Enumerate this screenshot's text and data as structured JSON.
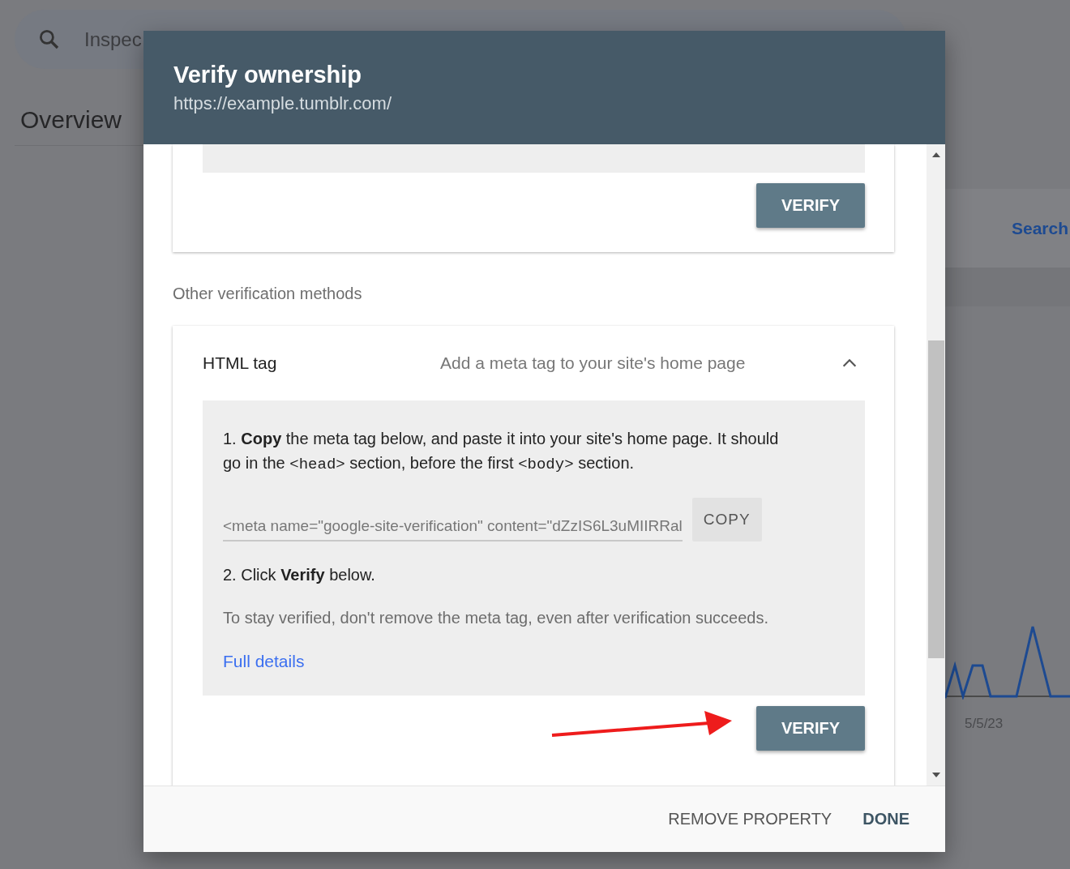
{
  "background": {
    "search": {
      "value": "Inspec"
    },
    "heading": "Overview",
    "link": "Search",
    "chart": {
      "date_label": "5/5/23"
    }
  },
  "dialog": {
    "title": "Verify ownership",
    "subtitle": "https://example.tumblr.com/",
    "top_card": {
      "button": "VERIFY"
    },
    "section_label": "Other verification methods",
    "method": {
      "name": "HTML tag",
      "description": "Add a meta tag to your site's home page",
      "expanded": true,
      "step1": [
        {
          "kind": "text",
          "text": "1. **Copy** the meta tag below, and paste it into your site's home page. It should go in the "
        },
        {
          "kind": "code",
          "text": "<head>"
        },
        {
          "kind": "text",
          "text": " section, before the first "
        },
        {
          "kind": "code",
          "text": "<body>"
        },
        {
          "kind": "text",
          "text": " section."
        }
      ],
      "meta_tag": "<meta name=\"google-site-verification\" content=\"dZzIS6L3uMIIRRal",
      "copy_button": "COPY",
      "step2": "2. Click **Verify** below.",
      "note": "To stay verified, don't remove the meta tag, even after verification succeeds.",
      "link": "Full details",
      "button": "VERIFY"
    },
    "footer_buttons": [
      "REMOVE PROPERTY",
      "DONE"
    ]
  }
}
